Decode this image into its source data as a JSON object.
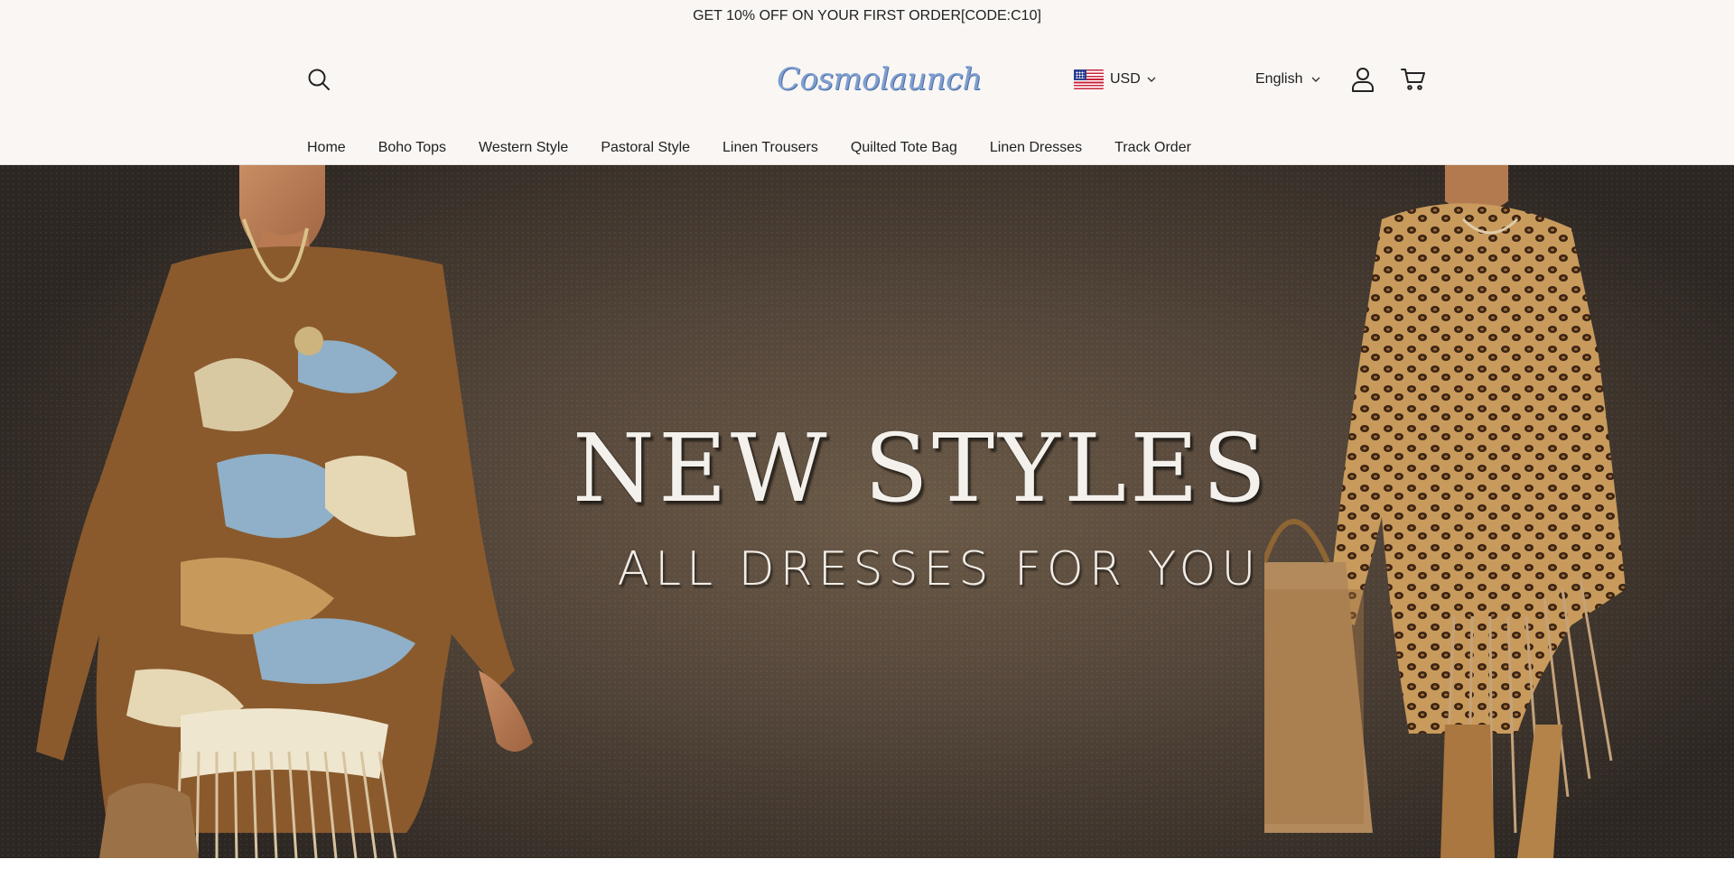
{
  "announcement": "GET 10% OFF ON YOUR FIRST ORDER[CODE:C10]",
  "header": {
    "logo_text": "Cosmolaunch",
    "currency": {
      "code": "USD",
      "flag": "us-flag-icon"
    },
    "language": "English",
    "icons": {
      "search": "search-icon",
      "account": "user-icon",
      "cart": "cart-icon"
    }
  },
  "nav": {
    "items": [
      {
        "label": "Home"
      },
      {
        "label": "Boho Tops"
      },
      {
        "label": "Western Style"
      },
      {
        "label": "Pastoral Style"
      },
      {
        "label": "Linen Trousers"
      },
      {
        "label": "Quilted Tote Bag"
      },
      {
        "label": "Linen Dresses"
      },
      {
        "label": "Track Order"
      }
    ]
  },
  "hero": {
    "headline": "NEW STYLES",
    "subheadline": "ALL DRESSES FOR YOU"
  },
  "colors": {
    "topbar_bg": "#f9f6f3",
    "logo": "#7f9fd0",
    "hero_bg": "#54463a",
    "hero_text": "#f4f1ec"
  }
}
